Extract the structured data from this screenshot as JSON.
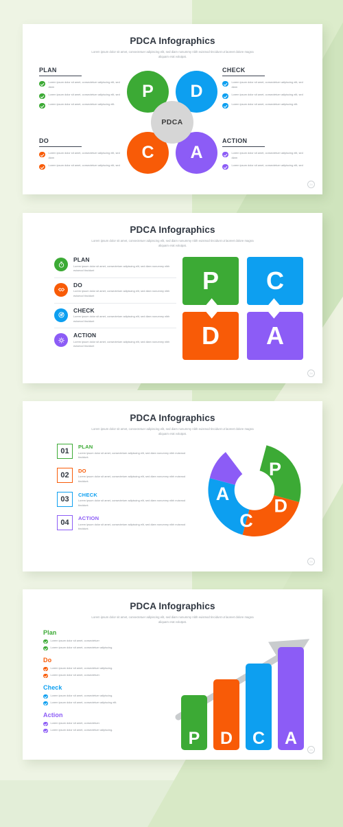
{
  "page": {
    "background_color": "#dceccb",
    "background_pale": "#eef4e4"
  },
  "palette": {
    "plan": "#3caa35",
    "do": "#f85b07",
    "check": "#0d9ff0",
    "action": "#8c5cf6",
    "hub": "#d6d6d6",
    "arrow": "#c9ccce",
    "title": "#2f3640",
    "body": "#8b9096"
  },
  "common": {
    "title": "PDCA Infographics",
    "subtitle": "Lorem ipsum dolor sit amet, consectetuer adipiscing elit, sed diam nonummy nibh euismod tincidunt ut laoreet dolore magna aliquam erat volutpat.",
    "watermark": "24"
  },
  "slide1": {
    "plan": {
      "heading": "PLAN",
      "color": "#3caa35",
      "letter": "P",
      "bullets": [
        "Lorem ipsum dolor sit amet, consectetuer adipiscing elit, sed diam",
        "Lorem ipsum dolor sit amet, consectetuer adipiscing elit, sed",
        "Lorem ipsum dolor sit amet, consectetuer adipiscing elit."
      ]
    },
    "do": {
      "heading": "DO",
      "color": "#f85b07",
      "letter": "C",
      "bullets": [
        "Lorem ipsum dolor sit amet, consectetuer adipiscing elit, sed diam",
        "Lorem ipsum dolor sit amet, consectetuer adipiscing elit, sed"
      ]
    },
    "check": {
      "heading": "CHECK",
      "color": "#0d9ff0",
      "letter": "D",
      "bullets": [
        "Lorem ipsum dolor sit amet, consectetuer adipiscing elit, sed diam",
        "Lorem ipsum dolor sit amet, consectetuer adipiscing elit, sed",
        "Lorem ipsum dolor sit amet, consectetuer adipiscing elit."
      ]
    },
    "action": {
      "heading": "ACTION",
      "color": "#8c5cf6",
      "letter": "A",
      "bullets": [
        "Lorem ipsum dolor sit amet, consectetuer adipiscing elit, sed diam",
        "Lorem ipsum dolor sit amet, consectetuer adipiscing elit, sed"
      ]
    },
    "hub_label": "PDCA"
  },
  "slide2": {
    "items": [
      {
        "name": "PLAN",
        "color": "#3caa35",
        "icon": "stopwatch-icon",
        "glyph": "⏱",
        "desc": "Lorem ipsum dolor sit amet, consectetuer adipiscing elit, sed diam nonummy nibh euismod tincidunt"
      },
      {
        "name": "DO",
        "color": "#f85b07",
        "icon": "handshake-icon",
        "glyph": "✋",
        "desc": "Lorem ipsum dolor sit amet, consectetuer adipiscing elit, sed diam nonummy nibh euismod tincidunt"
      },
      {
        "name": "CHECK",
        "color": "#0d9ff0",
        "icon": "target-icon",
        "glyph": "◎",
        "desc": "Lorem ipsum dolor sit amet, consectetuer adipiscing elit, sed diam nonummy nibh euismod tincidunt"
      },
      {
        "name": "ACTION",
        "color": "#8c5cf6",
        "icon": "gear-wrench-icon",
        "glyph": "⚙",
        "desc": "Lorem ipsum dolor sit amet, consectetuer adipiscing elit, sed diam nonummy nibh euismod tincidunt"
      }
    ],
    "bubbles": [
      {
        "letter": "P",
        "color": "#3caa35"
      },
      {
        "letter": "C",
        "color": "#0d9ff0"
      },
      {
        "letter": "D",
        "color": "#f85b07"
      },
      {
        "letter": "A",
        "color": "#8c5cf6"
      }
    ]
  },
  "slide3": {
    "items": [
      {
        "num": "01",
        "name": "PLAN",
        "color": "#3caa35",
        "desc": "Lorem ipsum dolor sit amet, consectetuer adipiscing elit, sed diam nonummy nibh euismod tincidunt."
      },
      {
        "num": "02",
        "name": "DO",
        "color": "#f85b07",
        "desc": "Lorem ipsum dolor sit amet, consectetuer adipiscing elit, sed diam nonummy nibh euismod tincidunt."
      },
      {
        "num": "03",
        "name": "CHECK",
        "color": "#0d9ff0",
        "desc": "Lorem ipsum dolor sit amet, consectetuer adipiscing elit, sed diam nonummy nibh euismod tincidunt."
      },
      {
        "num": "04",
        "name": "ACTION",
        "color": "#8c5cf6",
        "desc": "Lorem ipsum dolor sit amet, consectetuer adipiscing elit, sed diam nonummy nibh euismod tincidunt."
      }
    ]
  },
  "slide4": {
    "groups": [
      {
        "name": "Plan",
        "color": "#3caa35",
        "bullets": [
          "Lorem ipsum dolor sit amet, consectetuer",
          "Lorem ipsum dolor sit amet, consectetuer adipiscing."
        ]
      },
      {
        "name": "Do",
        "color": "#f85b07",
        "bullets": [
          "Lorem ipsum dolor sit amet, consectetuer adipiscing.",
          "Lorem ipsum dolor sit amet, consectetuer."
        ]
      },
      {
        "name": "Check",
        "color": "#0d9ff0",
        "bullets": [
          "Lorem ipsum dolor sit amet, consectetuer adipiscing.",
          "Lorem ipsum dolor sit amet, consectetuer adipiscing elit."
        ]
      },
      {
        "name": "Action",
        "color": "#8c5cf6",
        "bullets": [
          "Lorem ipsum dolor sit amet, consectetuer.",
          "Lorem ipsum dolor sit amet, consectetuer adipiscing."
        ]
      }
    ]
  },
  "chart_data": [
    {
      "type": "pie",
      "title": "PDCA Infographics",
      "subtitle": "PDCA cycle wheel — four equal quadrant circles around a PDCA hub",
      "categories": [
        "P",
        "D",
        "C",
        "A"
      ],
      "values": [
        25,
        25,
        25,
        25
      ],
      "colors": [
        "#3caa35",
        "#0d9ff0",
        "#f85b07",
        "#8c5cf6"
      ],
      "legend": [
        "PLAN",
        "CHECK",
        "DO",
        "ACTION"
      ],
      "legend_position": "left-and-right",
      "annotations": [
        "PDCA"
      ]
    },
    {
      "type": "table",
      "title": "PDCA Infographics",
      "subtitle": "Four speech-bubble tiles in a 2×2 grid",
      "categories": [
        "P",
        "C",
        "D",
        "A"
      ],
      "values": [
        1,
        1,
        1,
        1
      ],
      "colors": [
        "#3caa35",
        "#0d9ff0",
        "#f85b07",
        "#8c5cf6"
      ],
      "legend": [
        "PLAN",
        "DO",
        "CHECK",
        "ACTION"
      ],
      "legend_position": "left"
    },
    {
      "type": "pie",
      "title": "PDCA Infographics",
      "subtitle": "Donut chart with an open gap at the upper-left",
      "categories": [
        "P",
        "D",
        "C",
        "A"
      ],
      "values": [
        25,
        25,
        25,
        25
      ],
      "colors": [
        "#3caa35",
        "#f85b07",
        "#0d9ff0",
        "#8c5cf6"
      ],
      "legend": [
        "01 PLAN",
        "02 DO",
        "03 CHECK",
        "04 ACTION"
      ],
      "legend_position": "left",
      "start_angle_deg": 0,
      "gap_deg": 90,
      "inner_radius_ratio": 0.42
    },
    {
      "type": "bar",
      "title": "PDCA Infographics",
      "subtitle": "Ascending bars with a rising trend arrow",
      "categories": [
        "P",
        "D",
        "C",
        "A"
      ],
      "values": [
        55,
        72,
        88,
        105
      ],
      "colors": [
        "#3caa35",
        "#f85b07",
        "#0d9ff0",
        "#8c5cf6"
      ],
      "xlabel": "",
      "ylabel": "",
      "ylim": [
        0,
        120
      ],
      "grid": false,
      "legend": [
        "Plan",
        "Do",
        "Check",
        "Action"
      ],
      "legend_position": "left",
      "annotations": [
        "rising trend arrow"
      ]
    }
  ]
}
